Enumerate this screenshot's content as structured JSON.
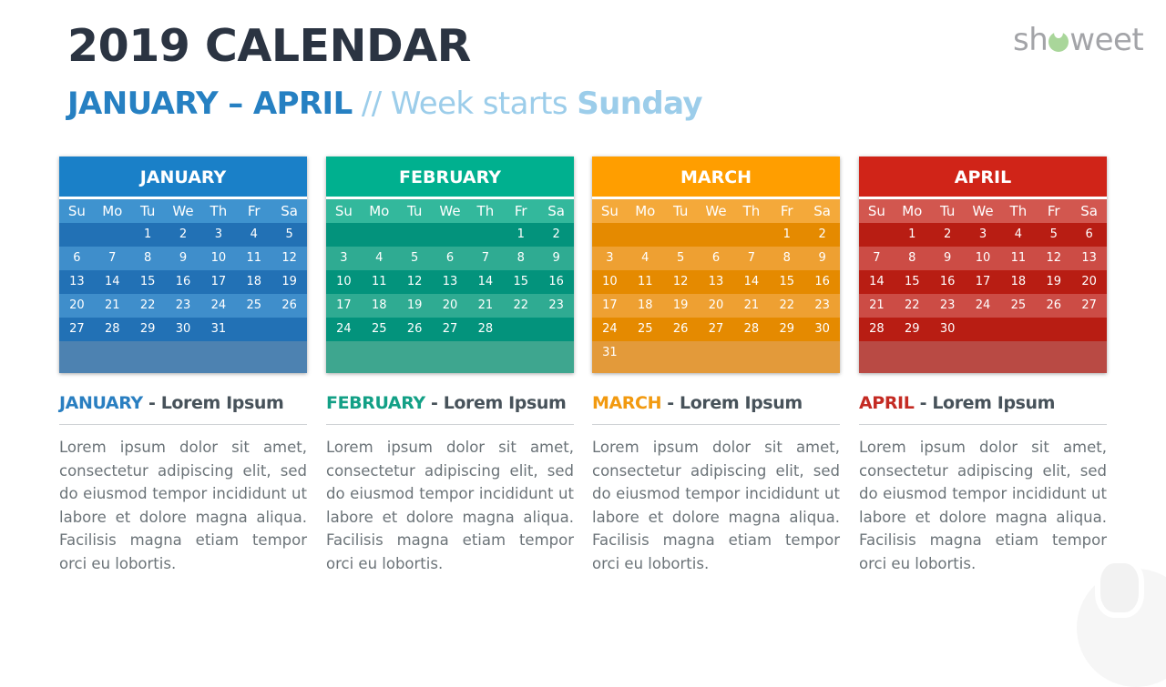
{
  "header": {
    "title": "2019 CALENDAR",
    "subtitle_range": "JANUARY – APRIL",
    "subtitle_sep": " // Week starts ",
    "subtitle_day": "Sunday"
  },
  "logo": {
    "prefix": "sh",
    "suffix": "weet",
    "icon": "heart-o-icon"
  },
  "weekdays": [
    "Su",
    "Mo",
    "Tu",
    "We",
    "Th",
    "Fr",
    "Sa"
  ],
  "months": [
    {
      "name": "JANUARY",
      "colors": {
        "head": "#1a80c8",
        "dow": "#3f93cf",
        "odd": "#2271b5",
        "even": "#3f8ecb",
        "last": "#4d82b1",
        "label": "#2a7fc1"
      },
      "weeks": [
        [
          "",
          "",
          "1",
          "2",
          "3",
          "4",
          "5"
        ],
        [
          "6",
          "7",
          "8",
          "9",
          "10",
          "11",
          "12"
        ],
        [
          "13",
          "14",
          "15",
          "16",
          "17",
          "18",
          "19"
        ],
        [
          "20",
          "21",
          "22",
          "23",
          "24",
          "25",
          "26"
        ],
        [
          "27",
          "28",
          "29",
          "30",
          "31",
          "",
          ""
        ]
      ],
      "info_title": "JANUARY",
      "info_suffix": " - Lorem Ipsum",
      "body": "Lorem ipsum dolor sit amet, consectetur adipiscing elit, sed do eiusmod tempor incididunt ut labore et dolore magna aliqua. Facilisis magna etiam tempor orci eu lobortis."
    },
    {
      "name": "FEBRUARY",
      "colors": {
        "head": "#00b08f",
        "dow": "#33b89c",
        "odd": "#03937c",
        "even": "#2fab92",
        "last": "#3ea68f",
        "label": "#13a086"
      },
      "weeks": [
        [
          "",
          "",
          "",
          "",
          "",
          "1",
          "2"
        ],
        [
          "3",
          "4",
          "5",
          "6",
          "7",
          "8",
          "9"
        ],
        [
          "10",
          "11",
          "12",
          "13",
          "14",
          "15",
          "16"
        ],
        [
          "17",
          "18",
          "19",
          "20",
          "21",
          "22",
          "23"
        ],
        [
          "24",
          "25",
          "26",
          "27",
          "28",
          "",
          ""
        ]
      ],
      "info_title": "FEBRUARY",
      "info_suffix": " - Lorem Ipsum",
      "body": "Lorem ipsum dolor sit amet, consectetur adipiscing elit, sed do eiusmod tempor incididunt ut labore et dolore magna aliqua. Facilisis magna etiam tempor orci eu lobortis."
    },
    {
      "name": "MARCH",
      "colors": {
        "head": "#ff9e00",
        "dow": "#f4a93a",
        "odd": "#e58a00",
        "even": "#eea032",
        "last": "#e39a3a",
        "label": "#f29a10"
      },
      "weeks": [
        [
          "",
          "",
          "",
          "",
          "",
          "1",
          "2"
        ],
        [
          "3",
          "4",
          "5",
          "6",
          "7",
          "8",
          "9"
        ],
        [
          "10",
          "11",
          "12",
          "13",
          "14",
          "15",
          "16"
        ],
        [
          "17",
          "18",
          "19",
          "20",
          "21",
          "22",
          "23"
        ],
        [
          "24",
          "25",
          "26",
          "27",
          "28",
          "29",
          "30"
        ],
        [
          "31",
          "",
          "",
          "",
          "",
          "",
          ""
        ]
      ],
      "info_title": "MARCH",
      "info_suffix": " - Lorem Ipsum",
      "body": "Lorem ipsum dolor sit amet, consectetur adipiscing elit, sed do eiusmod tempor incididunt ut labore et dolore magna aliqua. Facilisis magna etiam tempor orci eu lobortis."
    },
    {
      "name": "APRIL",
      "colors": {
        "head": "#d02418",
        "dow": "#d2574f",
        "odd": "#b81d13",
        "even": "#cc4c45",
        "last": "#b94a44",
        "label": "#c42b23"
      },
      "weeks": [
        [
          "",
          "1",
          "2",
          "3",
          "4",
          "5",
          "6"
        ],
        [
          "7",
          "8",
          "9",
          "10",
          "11",
          "12",
          "13"
        ],
        [
          "14",
          "15",
          "16",
          "17",
          "18",
          "19",
          "20"
        ],
        [
          "21",
          "22",
          "23",
          "24",
          "25",
          "26",
          "27"
        ],
        [
          "28",
          "29",
          "30",
          "",
          "",
          "",
          ""
        ]
      ],
      "info_title": "APRIL",
      "info_suffix": " - Lorem Ipsum",
      "body": "Lorem ipsum dolor sit amet, consectetur adipiscing elit, sed do eiusmod tempor incididunt ut labore et dolore magna aliqua. Facilisis magna etiam tempor orci eu lobortis."
    }
  ]
}
